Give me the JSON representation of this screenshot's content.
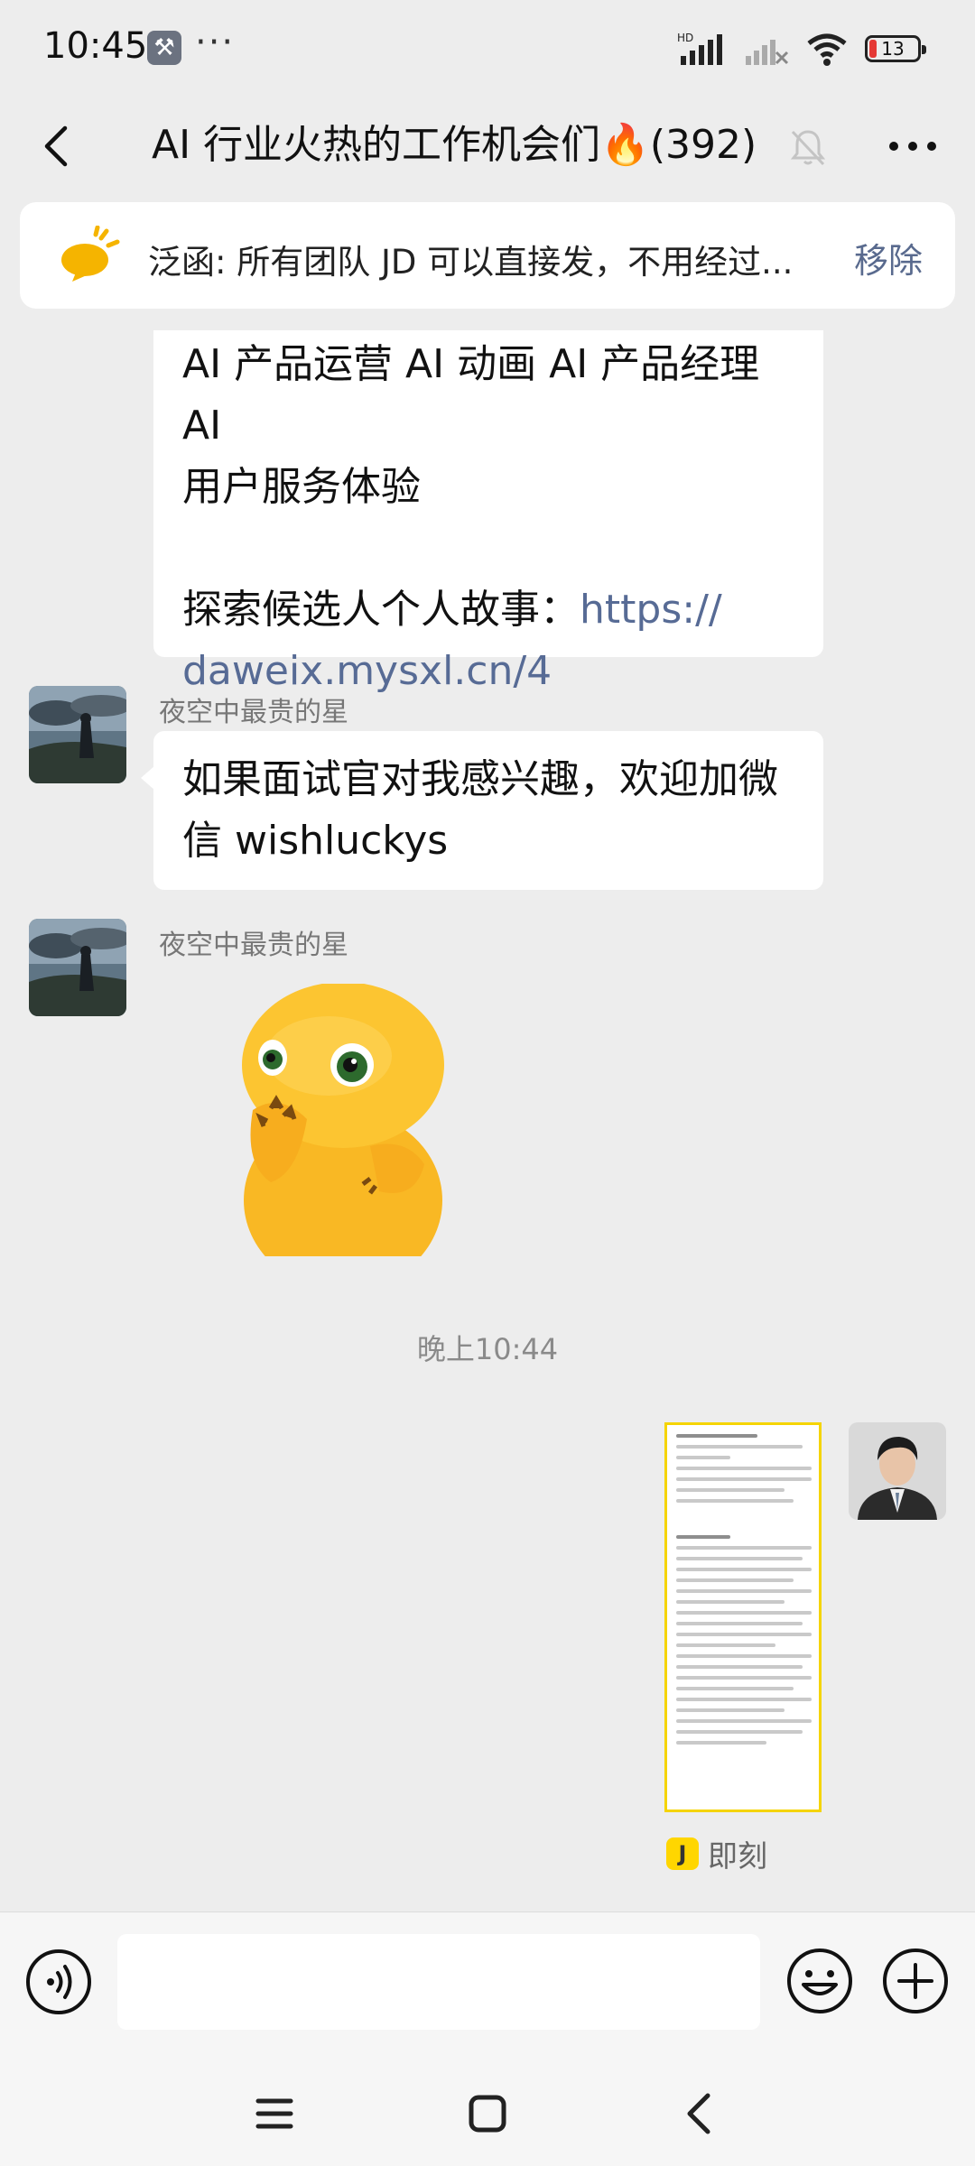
{
  "status_bar": {
    "time": "10:45",
    "dots": "···",
    "network_label": "HD",
    "battery_level": "13"
  },
  "header": {
    "title": "AI 行业火热的工作机会们🔥(392)"
  },
  "pinned": {
    "text": "泛函: 所有团队 JD 可以直接发，不用经过...",
    "remove_label": "移除"
  },
  "messages": [
    {
      "sender": "",
      "lines": [
        "AI 产品运营 AI 动画 AI 产品经理 AI",
        "用户服务体验",
        "",
        "探索候选人个人故事："
      ],
      "link_part1": "https://",
      "link_part2": "daweix.mysxl.cn/4"
    },
    {
      "sender": "夜空中最贵的星",
      "lines": [
        "如果面试官对我感兴趣，欢迎加微",
        "信 wishluckys"
      ]
    },
    {
      "sender": "夜空中最贵的星",
      "sticker": "yellow-creature-sticker"
    }
  ],
  "time_separator": "晚上10:44",
  "outgoing": {
    "card_source": "即刻",
    "card_source_badge": "J"
  },
  "input": {
    "value": "",
    "placeholder": ""
  },
  "colors": {
    "background": "#ededed",
    "bubble": "#ffffff",
    "link": "#576b95",
    "remove": "#596a8e",
    "jike_yellow": "#ffd600"
  }
}
